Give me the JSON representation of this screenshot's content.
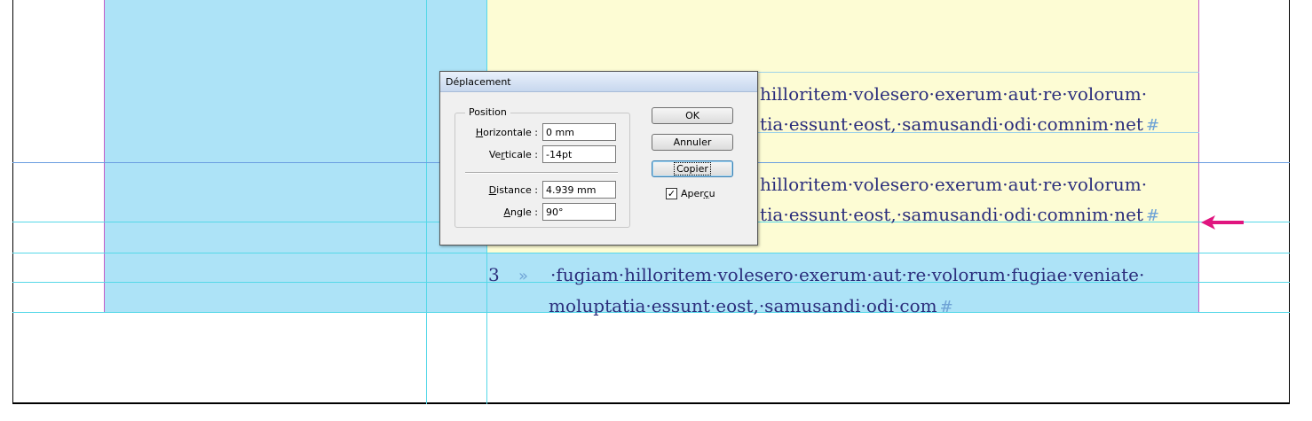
{
  "document": {
    "paragraph1": {
      "line1": "hilloritem·volesero·exerum·aut·re·volorum·",
      "line2": "tia·essunt·eost,·samusandi·odi·comnim·net",
      "end_mark": "#"
    },
    "paragraph2": {
      "line1": "hilloritem·volesero·exerum·aut·re·volorum·",
      "line2": "tia·essunt·eost,·samusandi·odi·comnim·net",
      "end_mark": "#"
    },
    "paragraph3": {
      "number": "3",
      "tab_mark": "»",
      "line1": "·fugiam·hilloritem·volesero·exerum·aut·re·volorum·fugiae·veniate·",
      "line2": "moluptatia·essunt·eost,·samusandi·odi·com",
      "end_mark": "#"
    }
  },
  "dialog": {
    "title": "Déplacement",
    "position_group_label": "Position",
    "horizontal": {
      "label_pre": "",
      "label_u": "H",
      "label_post": "orizontale :",
      "value": "0 mm"
    },
    "vertical": {
      "label_pre": "Ve",
      "label_u": "r",
      "label_post": "ticale :",
      "value": "-14pt"
    },
    "distance": {
      "label_pre": "",
      "label_u": "D",
      "label_post": "istance :",
      "value": "4.939 mm"
    },
    "angle": {
      "label_pre": "",
      "label_u": "A",
      "label_post": "ngle :",
      "value": "90°"
    },
    "buttons": {
      "ok": "OK",
      "cancel": "Annuler",
      "copy": "Copier"
    },
    "preview": {
      "label_pre": "Aper",
      "label_u": "ç",
      "label_post": "u",
      "checked": true,
      "check_glyph": "✓"
    }
  },
  "colors": {
    "frame_blue": "#ade3f7",
    "frame_yellow": "#fdfcd4",
    "guide_cyan": "#56d8e8",
    "margin_magenta": "#c45cc8",
    "text_navy": "#2b2e7c",
    "arrow_pink": "#e0157f"
  },
  "icons": {
    "arrow": "left-arrow-icon",
    "checkbox": "checkbox-checked-icon"
  }
}
